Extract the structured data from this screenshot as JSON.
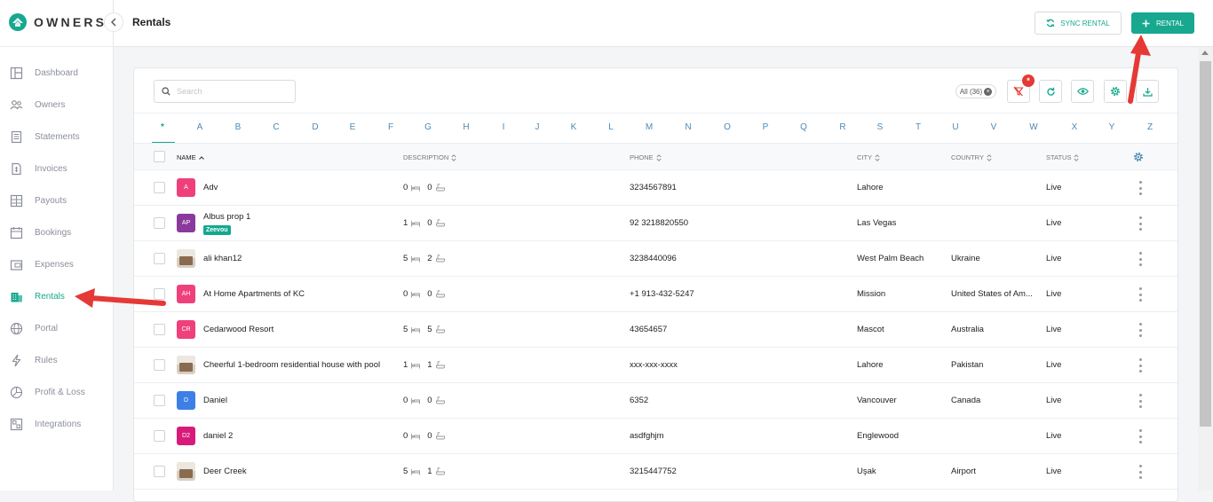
{
  "app": {
    "brand": "OWNERS",
    "accent": "#14a890",
    "arrow_color": "#e53935"
  },
  "sidebar": {
    "items": [
      {
        "label": "Dashboard",
        "icon": "dashboard-icon",
        "active": false
      },
      {
        "label": "Owners",
        "icon": "people-icon",
        "active": false
      },
      {
        "label": "Statements",
        "icon": "statement-icon",
        "active": false
      },
      {
        "label": "Invoices",
        "icon": "invoice-icon",
        "active": false
      },
      {
        "label": "Payouts",
        "icon": "payout-icon",
        "active": false
      },
      {
        "label": "Bookings",
        "icon": "calendar-icon",
        "active": false
      },
      {
        "label": "Expenses",
        "icon": "wallet-icon",
        "active": false
      },
      {
        "label": "Rentals",
        "icon": "building-icon",
        "active": true
      },
      {
        "label": "Portal",
        "icon": "globe-icon",
        "active": false
      },
      {
        "label": "Rules",
        "icon": "bolt-icon",
        "active": false
      },
      {
        "label": "Profit & Loss",
        "icon": "pie-icon",
        "active": false
      },
      {
        "label": "Integrations",
        "icon": "integration-icon",
        "active": false
      }
    ]
  },
  "header": {
    "title": "Rentals",
    "sync_label": "SYNC RENTAL",
    "add_label": "RENTAL"
  },
  "toolbar": {
    "search_placeholder": "Search",
    "all_label": "All (36)",
    "filter_badge": "*"
  },
  "letters": [
    "*",
    "A",
    "B",
    "C",
    "D",
    "E",
    "F",
    "G",
    "H",
    "I",
    "J",
    "K",
    "L",
    "M",
    "N",
    "O",
    "P",
    "Q",
    "R",
    "S",
    "T",
    "U",
    "V",
    "W",
    "X",
    "Y",
    "Z"
  ],
  "table": {
    "columns": {
      "name": "NAME",
      "description": "DESCRIPTION",
      "phone": "PHONE",
      "city": "CITY",
      "country": "COUNTRY",
      "status": "STATUS"
    },
    "rows": [
      {
        "initials": "A",
        "avatar_color": "#f0407b",
        "name": "Adv",
        "tag": "",
        "beds": "0",
        "baths": "0",
        "phone": "3234567891",
        "city": "Lahore",
        "country": "",
        "status": "Live"
      },
      {
        "initials": "AP",
        "avatar_color": "#8a3a9c",
        "name": "Albus prop 1",
        "tag": "Zeevou",
        "beds": "1",
        "baths": "0",
        "phone": "92 3218820550",
        "city": "Las Vegas",
        "country": "",
        "status": "Live"
      },
      {
        "initials": "",
        "avatar_color": "photo",
        "name": "ali khan12",
        "tag": "",
        "beds": "5",
        "baths": "2",
        "phone": "3238440096",
        "city": "West Palm Beach",
        "country": "Ukraine",
        "status": "Live"
      },
      {
        "initials": "AH",
        "avatar_color": "#f0407b",
        "name": "At Home Apartments of KC",
        "tag": "",
        "beds": "0",
        "baths": "0",
        "phone": "+1 913-432-5247",
        "city": "Mission",
        "country": "United States of Am...",
        "status": "Live"
      },
      {
        "initials": "CR",
        "avatar_color": "#f0407b",
        "name": "Cedarwood Resort",
        "tag": "",
        "beds": "5",
        "baths": "5",
        "phone": "43654657",
        "city": "Mascot",
        "country": "Australia",
        "status": "Live"
      },
      {
        "initials": "",
        "avatar_color": "photo",
        "name": "Cheerful 1-bedroom residential house with pool",
        "tag": "",
        "beds": "1",
        "baths": "1",
        "phone": "xxx-xxx-xxxx",
        "city": "Lahore",
        "country": "Pakistan",
        "status": "Live"
      },
      {
        "initials": "D",
        "avatar_color": "#3d7fe6",
        "name": "Daniel",
        "tag": "",
        "beds": "0",
        "baths": "0",
        "phone": "6352",
        "city": "Vancouver",
        "country": "Canada",
        "status": "Live"
      },
      {
        "initials": "D2",
        "avatar_color": "#d81b7a",
        "name": "daniel 2",
        "tag": "",
        "beds": "0",
        "baths": "0",
        "phone": "asdfghjm",
        "city": "Englewood",
        "country": "",
        "status": "Live"
      },
      {
        "initials": "",
        "avatar_color": "photo",
        "name": "Deer Creek",
        "tag": "",
        "beds": "5",
        "baths": "1",
        "phone": "3215447752",
        "city": "Uşak",
        "country": "Airport",
        "status": "Live"
      }
    ]
  }
}
